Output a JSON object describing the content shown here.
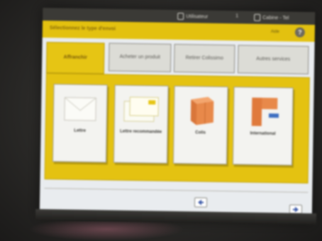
{
  "status_bar": {
    "user_text": "Utilisateur",
    "count": "1",
    "phone_text": "Cabine - Tel"
  },
  "header": {
    "title": "Sélectionnez le type d'envoi",
    "right_text": "Aide",
    "help_symbol": "?"
  },
  "tabs": [
    {
      "label": "Affranchir",
      "active": true
    },
    {
      "label": "Acheter un produit",
      "active": false
    },
    {
      "label": "Retirer Colissimo",
      "active": false
    },
    {
      "label": "Autres services",
      "active": false
    }
  ],
  "products": [
    {
      "label": "Lettre",
      "icon": "letter-icon"
    },
    {
      "label": "Lettre recommandée",
      "icon": "registered-letter-icon"
    },
    {
      "label": "Colis",
      "icon": "parcel-icon"
    },
    {
      "label": "International",
      "icon": "international-parcel-icon"
    }
  ],
  "colors": {
    "accent_yellow": "#e3c10f",
    "tab_active": "#e6c514",
    "screen_bg": "#e9ecef",
    "parcel_orange": "#e8894a"
  }
}
